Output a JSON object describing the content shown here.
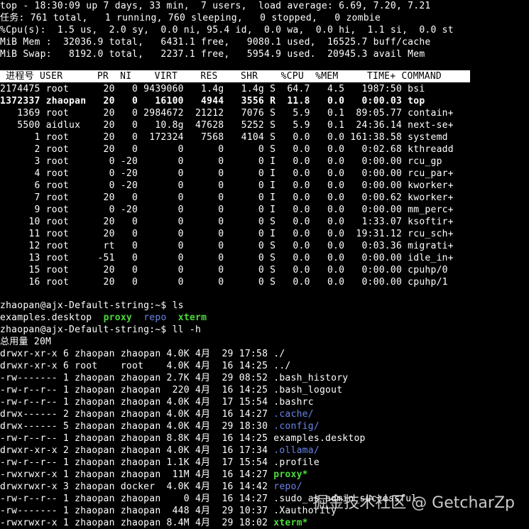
{
  "top_header": {
    "line1": "top - 18:30:09 up 7 days, 33 min,  7 users,  load average: 6.69, 7.20, 7.21",
    "line2": "任务: 761 total,   1 running, 760 sleeping,   0 stopped,   0 zombie",
    "line3": "%Cpu(s):  1.5 us,  2.0 sy,  0.0 ni, 95.4 id,  0.0 wa,  0.0 hi,  1.1 si,  0.0 st",
    "line4": "MiB Mem :  32036.9 total,   6431.1 free,   9080.1 used,  16525.7 buff/cache",
    "line5": "MiB Swap:   8192.0 total,   2237.1 free,   5954.9 used.  20945.3 avail Mem"
  },
  "proc_table": {
    "header": " 进程号 USER      PR  NI    VIRT    RES    SHR    %CPU  %MEM     TIME+ COMMAND     ",
    "rows": [
      {
        "text": "2174475 root      20   0 9439060   1.4g   1.4g S  64.7   4.5   1987:50 bsi",
        "bold": false
      },
      {
        "text": "1372337 zhaopan   20   0   16100   4944   3556 R  11.8   0.0   0:00.03 top",
        "bold": true
      },
      {
        "text": "   1369 root      20   0 2984672  21212   7076 S   5.9   0.1  89:05.77 contain+",
        "bold": false
      },
      {
        "text": "   5500 aidlux    20   0   10.8g  47628   5252 S   5.9   0.1  24:36.14 next-se+",
        "bold": false
      },
      {
        "text": "      1 root      20   0  172324   7568   4104 S   0.0   0.0 161:38.58 systemd",
        "bold": false
      },
      {
        "text": "      2 root      20   0       0      0      0 S   0.0   0.0   0:02.68 kthreadd",
        "bold": false
      },
      {
        "text": "      3 root       0 -20       0      0      0 I   0.0   0.0   0:00.00 rcu_gp",
        "bold": false
      },
      {
        "text": "      4 root       0 -20       0      0      0 I   0.0   0.0   0:00.00 rcu_par+",
        "bold": false
      },
      {
        "text": "      6 root       0 -20       0      0      0 I   0.0   0.0   0:00.00 kworker+",
        "bold": false
      },
      {
        "text": "      7 root      20   0       0      0      0 I   0.0   0.0   0:00.62 kworker+",
        "bold": false
      },
      {
        "text": "      9 root       0 -20       0      0      0 I   0.0   0.0   0:00.00 mm_perc+",
        "bold": false
      },
      {
        "text": "     10 root      20   0       0      0      0 S   0.0   0.0   1:33.07 ksoftir+",
        "bold": false
      },
      {
        "text": "     11 root      20   0       0      0      0 I   0.0   0.0  19:31.12 rcu_sch+",
        "bold": false
      },
      {
        "text": "     12 root      rt   0       0      0      0 S   0.0   0.0   0:03.36 migrati+",
        "bold": false
      },
      {
        "text": "     13 root     -51   0       0      0      0 S   0.0   0.0   0:00.00 idle_in+",
        "bold": false
      },
      {
        "text": "     15 root      20   0       0      0      0 S   0.0   0.0   0:00.00 cpuhp/0",
        "bold": false
      },
      {
        "text": "     16 root      20   0       0      0      0 S   0.0   0.0   0:00.00 cpuhp/1",
        "bold": false
      }
    ]
  },
  "shell": {
    "prompt1": "zhaopan@ajx-Default-string:~$ ls",
    "ls_output": {
      "file1": "examples.desktop",
      "sep": "  ",
      "proxy": "proxy",
      "repo": "repo",
      "xterm": "xterm"
    },
    "prompt2": "zhaopan@ajx-Default-string:~$ ll -h",
    "total": "总用量 20M",
    "listing": [
      {
        "meta": "drwxr-xr-x 6 zhaopan zhaopan 4.0K 4月  29 17:58 ",
        "name": "./",
        "kind": "plain"
      },
      {
        "meta": "drwxr-xr-x 6 root    root    4.0K 4月  16 14:25 ",
        "name": "../",
        "kind": "plain"
      },
      {
        "meta": "-rw------- 1 zhaopan zhaopan 2.7K 4月  29 08:52 ",
        "name": ".bash_history",
        "kind": "plain"
      },
      {
        "meta": "-rw-r--r-- 1 zhaopan zhaopan  220 4月  16 14:25 ",
        "name": ".bash_logout",
        "kind": "plain"
      },
      {
        "meta": "-rw-r--r-- 1 zhaopan zhaopan 4.0K 4月  17 15:54 ",
        "name": ".bashrc",
        "kind": "plain"
      },
      {
        "meta": "drwx------ 2 zhaopan zhaopan 4.0K 4月  16 14:27 ",
        "name": ".cache/",
        "kind": "dir"
      },
      {
        "meta": "drwx------ 5 zhaopan zhaopan 4.0K 4月  29 18:30 ",
        "name": ".config/",
        "kind": "dir"
      },
      {
        "meta": "-rw-r--r-- 1 zhaopan zhaopan 8.8K 4月  16 14:25 ",
        "name": "examples.desktop",
        "kind": "plain"
      },
      {
        "meta": "drwxr-xr-x 2 zhaopan zhaopan 4.0K 4月  16 17:34 ",
        "name": ".ollama/",
        "kind": "dir"
      },
      {
        "meta": "-rw-r--r-- 1 zhaopan zhaopan 1.1K 4月  17 15:54 ",
        "name": ".profile",
        "kind": "plain"
      },
      {
        "meta": "-rwxrwxr-x 1 zhaopan zhaopan  11M 4月  16 14:27 ",
        "name": "proxy*",
        "kind": "exec"
      },
      {
        "meta": "drwxrwxr-x 3 zhaopan docker  4.0K 4月  16 14:42 ",
        "name": "repo/",
        "kind": "dir"
      },
      {
        "meta": "-rw-r--r-- 1 zhaopan zhaopan    0 4月  16 14:27 ",
        "name": ".sudo_as_admin_successful",
        "kind": "plain"
      },
      {
        "meta": "-rw------- 1 zhaopan zhaopan  448 4月  29 10:37 ",
        "name": ".Xauthority",
        "kind": "plain"
      },
      {
        "meta": "-rwxrwxr-x 1 zhaopan zhaopan 8.4M 4月  29 18:02 ",
        "name": "xterm*",
        "kind": "exec"
      }
    ]
  },
  "watermark": "掘金技术社区 @ GetcharZp",
  "colors": {
    "background": "#000000",
    "text": "#ffffff",
    "exec": "#4ddb3b",
    "dir": "#6a85e8",
    "header_bg": "#ffffff"
  }
}
